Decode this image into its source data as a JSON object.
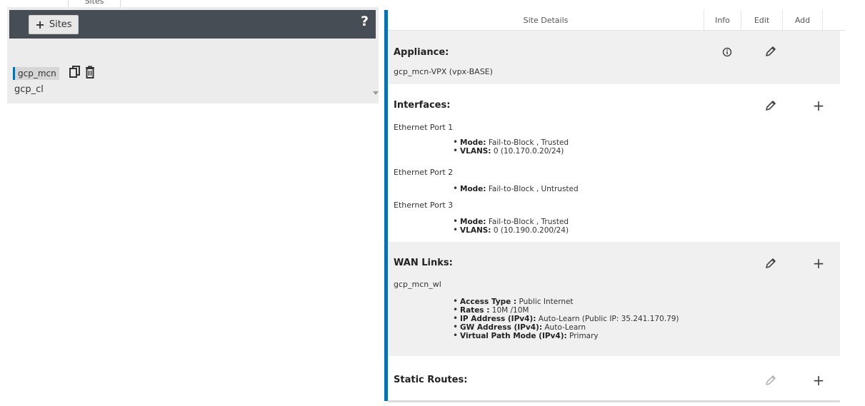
{
  "top_tab": {
    "label": "Sites"
  },
  "left": {
    "add_sites_label": "Sites",
    "help_label": "?",
    "selected_site": "gcp_mcn",
    "sub_site": "gcp_cl"
  },
  "columns": {
    "details": "Site Details",
    "info": "Info",
    "edit": "Edit",
    "add": "Add"
  },
  "appliance": {
    "title": "Appliance:",
    "value": "gcp_mcn-VPX (vpx-BASE)"
  },
  "interfaces": {
    "title": "Interfaces:",
    "ports": [
      {
        "name": "Ethernet Port 1",
        "items": [
          {
            "key": "Mode:",
            "value": " Fail-to-Block , Trusted"
          },
          {
            "key": "VLANS:",
            "value": " 0 (10.170.0.20/24)"
          }
        ]
      },
      {
        "name": "Ethernet Port 2",
        "items": [
          {
            "key": "Mode:",
            "value": " Fail-to-Block , Untrusted"
          }
        ]
      },
      {
        "name": "Ethernet Port 3",
        "items": [
          {
            "key": "Mode:",
            "value": " Fail-to-Block , Trusted"
          },
          {
            "key": "VLANS:",
            "value": " 0 (10.190.0.200/24)"
          }
        ]
      }
    ]
  },
  "wan_links": {
    "title": "WAN Links:",
    "link_name": "gcp_mcn_wl",
    "items": [
      {
        "key": "Access Type :",
        "value": " Public Internet"
      },
      {
        "key": "Rates :",
        "value": " 10M /10M"
      },
      {
        "key": "IP Address (IPv4):",
        "value": " Auto-Learn (Public IP: 35.241.170.79)"
      },
      {
        "key": "GW Address (IPv4):",
        "value": " Auto-Learn"
      },
      {
        "key": "Virtual Path Mode (IPv4):",
        "value": " Primary"
      }
    ]
  },
  "static_routes": {
    "title": "Static Routes:"
  },
  "colors": {
    "accent": "#0a6fb5",
    "header_dark": "#474d54",
    "gray_section": "#f0f0f0"
  }
}
